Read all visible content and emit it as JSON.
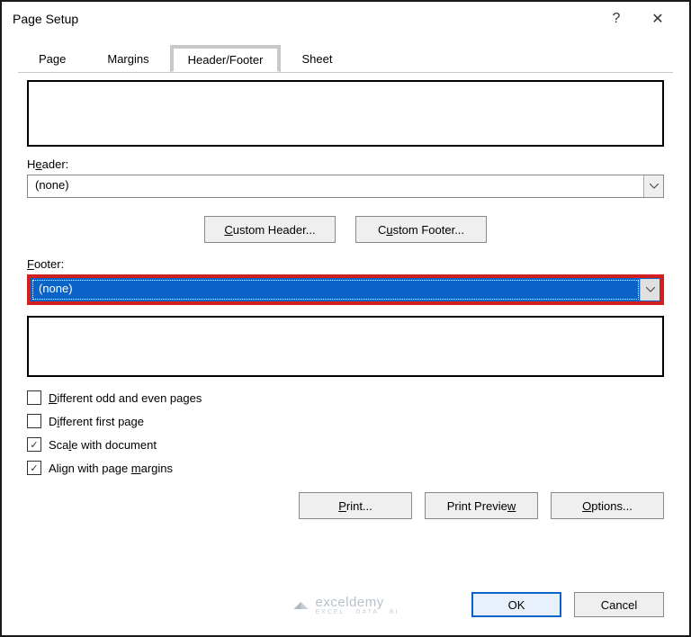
{
  "title": "Page Setup",
  "help_symbol": "?",
  "close_symbol": "✕",
  "tabs": {
    "page": "Page",
    "margins": "Margins",
    "header_footer": "Header/Footer",
    "sheet": "Sheet"
  },
  "header_section": {
    "label": "Header:",
    "value": "(none)"
  },
  "custom_buttons": {
    "custom_header": "Custom Header...",
    "custom_footer": "Custom Footer..."
  },
  "footer_section": {
    "label": "Footer:",
    "value": "(none)"
  },
  "checkboxes": {
    "diff_odd_even": {
      "label": "Different odd and even pages",
      "checked": false
    },
    "diff_first": {
      "label": "Different first page",
      "checked": false
    },
    "scale_doc": {
      "label": "Scale with document",
      "checked": true
    },
    "align_margins": {
      "label": "Align with page margins",
      "checked": true
    }
  },
  "action_buttons": {
    "print": "Print...",
    "print_preview": "Print Preview",
    "options": "Options..."
  },
  "dialog_buttons": {
    "ok": "OK",
    "cancel": "Cancel"
  },
  "watermark": {
    "main": "exceldemy",
    "sub": "EXCEL · DATA · BI"
  }
}
